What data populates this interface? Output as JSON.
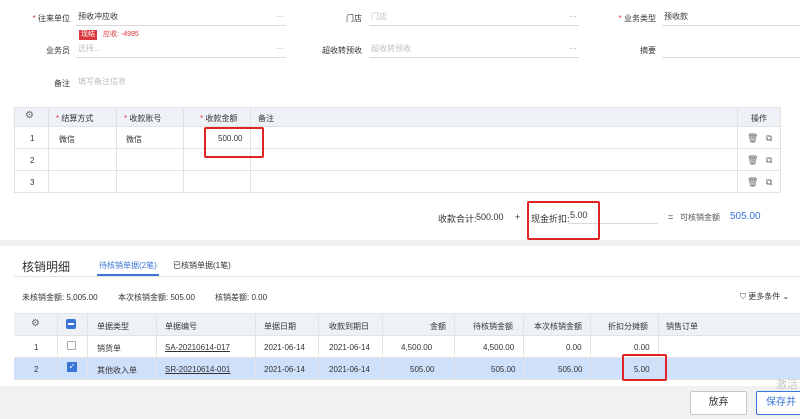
{
  "form": {
    "partner_label": "往来单位",
    "partner_value": "预收冲应收",
    "partner_badge": "现结",
    "partner_receivable": "应收: -4995",
    "store_label": "门店",
    "store_placeholder": "门店",
    "business_type_label": "业务类型",
    "business_type_value": "预收款",
    "salesperson_label": "业务员",
    "salesperson_placeholder": "选择...",
    "over_receipt_label": "超收转预收",
    "over_receipt_placeholder": "超收转预收",
    "summary_label": "摘要",
    "remark_label": "备注",
    "remark_placeholder": "填写备注信息",
    "more_dots": "···"
  },
  "payment_table": {
    "headers": {
      "method": "结算方式",
      "account": "收款账号",
      "amount": "收款金额",
      "remark": "备注",
      "ops": "操作"
    },
    "rows": [
      {
        "no": "1",
        "method": "微信",
        "account": "微信",
        "amount": "500.00"
      },
      {
        "no": "2",
        "method": "",
        "account": "",
        "amount": ""
      },
      {
        "no": "3",
        "method": "",
        "account": "",
        "amount": ""
      }
    ]
  },
  "totals": {
    "received_label": "收款合计:",
    "received_value": "500.00",
    "plus": "+",
    "discount_label": "现金折扣:",
    "discount_value": "5.00",
    "equals": "=",
    "writeoff_label": "可核销金额",
    "writeoff_value": "505.00"
  },
  "writeoff": {
    "title": "核销明细",
    "tab_pending": "待核销单据(2笔)",
    "tab_done": "已核销单据(1笔)",
    "unwritten_label": "未核销金额: 5,005.00",
    "current_label": "本次核销金额: 505.00",
    "diff_label": "核销差额: 0.00",
    "more_filters": "更多条件",
    "headers": {
      "type": "单据类型",
      "code": "单据编号",
      "date": "单据日期",
      "due": "收款到期日",
      "amount": "金额",
      "pending": "待核销金额",
      "current": "本次核销金额",
      "discount": "折扣分摊额",
      "order": "销售订单"
    },
    "rows": [
      {
        "no": "1",
        "type": "销货单",
        "code": "SA-20210614-017",
        "date": "2021-06-14",
        "due": "2021-06-14",
        "amount": "4,500.00",
        "pending": "4,500.00",
        "current": "0.00",
        "discount": "0.00",
        "order": ""
      },
      {
        "no": "2",
        "type": "其他收入单",
        "code": "SR-20210614-001",
        "date": "2021-06-14",
        "due": "2021-06-14",
        "amount": "505.00",
        "pending": "505.00",
        "current": "505.00",
        "discount": "5.00",
        "order": ""
      }
    ]
  },
  "footer": {
    "discard": "放弃",
    "save": "保存并",
    "watermark": "激活"
  },
  "colors": {
    "accent": "#3a75d6",
    "highlight_red": "#e02424",
    "badge_red": "#d9363e",
    "selected_row": "#cfe0fb"
  }
}
